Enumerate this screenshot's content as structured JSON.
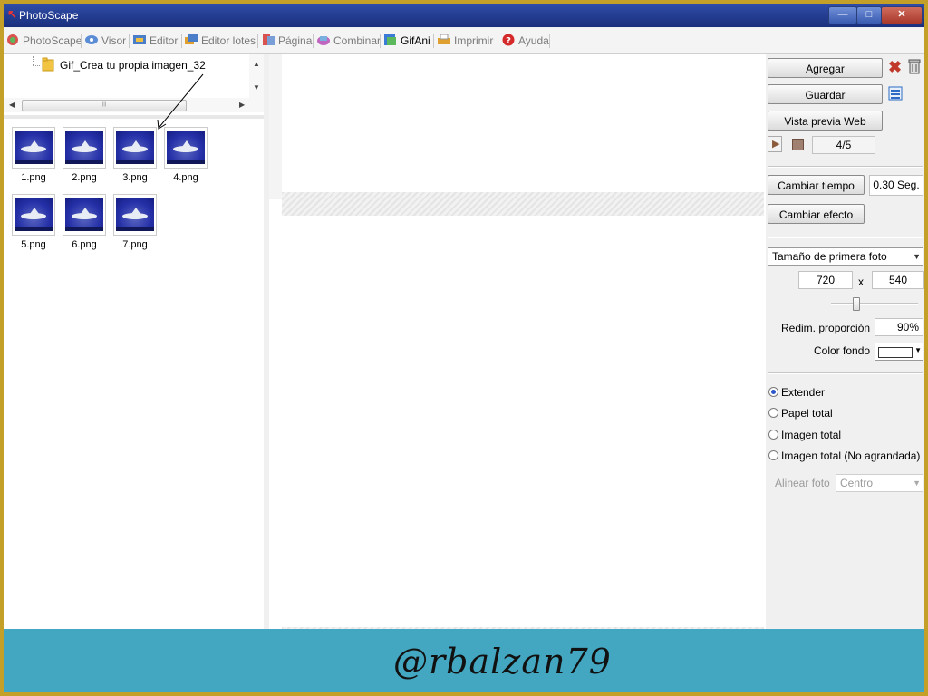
{
  "window": {
    "title": "PhotoScape"
  },
  "tabs": [
    {
      "label": "PhotoScape",
      "active": false
    },
    {
      "label": "Visor",
      "active": false
    },
    {
      "label": "Editor",
      "active": false
    },
    {
      "label": "Editor lotes",
      "active": false
    },
    {
      "label": "Página",
      "active": false
    },
    {
      "label": "Combinar",
      "active": false
    },
    {
      "label": "GifAni",
      "active": true
    },
    {
      "label": "Imprimir",
      "active": false
    },
    {
      "label": "Ayuda",
      "active": false
    }
  ],
  "tree": {
    "folder": "Gif_Crea tu propia imagen_32"
  },
  "thumbnails": [
    "1.png",
    "2.png",
    "3.png",
    "4.png",
    "5.png",
    "6.png",
    "7.png"
  ],
  "panel": {
    "add_button": "Agregar",
    "save_button": "Guardar",
    "preview_button": "Vista previa Web",
    "frame_counter": "4/5",
    "change_time_button": "Cambiar tiempo",
    "time_value": "0.30 Seg.",
    "change_effect_button": "Cambiar efecto",
    "size_select": "Tamaño de primera foto",
    "width": "720",
    "times": "x",
    "height": "540",
    "resize_label": "Redim. proporción",
    "resize_value": "90%",
    "bg_color_label": "Color fondo",
    "radio_options": [
      {
        "label": "Extender",
        "checked": true
      },
      {
        "label": "Papel total",
        "checked": false
      },
      {
        "label": "Imagen total",
        "checked": false
      },
      {
        "label": "Imagen total (No agrandada)",
        "checked": false
      }
    ],
    "align_label": "Alinear foto",
    "align_select": "Centro"
  },
  "watermark": "@rbalzan79",
  "colors": {
    "frame": "#c5a029",
    "footer": "#44a7c1",
    "titlebar": "#1b2f7c"
  }
}
